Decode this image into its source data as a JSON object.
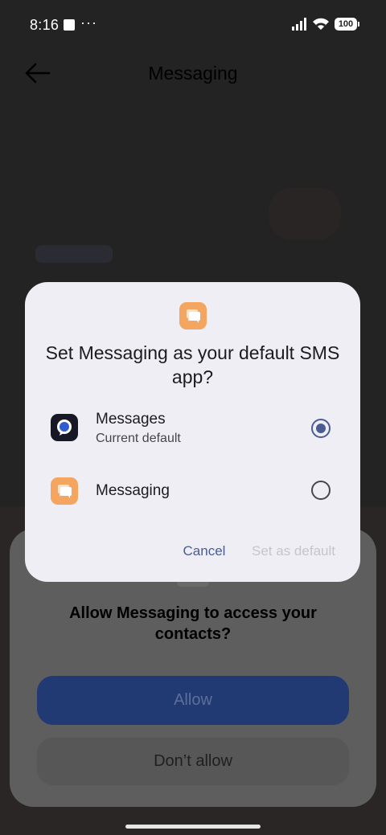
{
  "status_bar": {
    "time": "8:16",
    "dots": "···",
    "battery": "100"
  },
  "header": {
    "title": "Messaging"
  },
  "dialog": {
    "title": "Set Messaging as your default SMS app?",
    "options": [
      {
        "name": "Messages",
        "subtitle": "Current default",
        "selected": true
      },
      {
        "name": "Messaging",
        "subtitle": "",
        "selected": false
      }
    ],
    "cancel_label": "Cancel",
    "set_default_label": "Set as default"
  },
  "permission": {
    "title": "Allow Messaging to access your contacts?",
    "allow_label": "Allow",
    "deny_label": "Don’t allow"
  },
  "colors": {
    "accent": "#4b5c92",
    "dialog_bg": "#efeef4",
    "app_icon": "#f4a55f"
  }
}
